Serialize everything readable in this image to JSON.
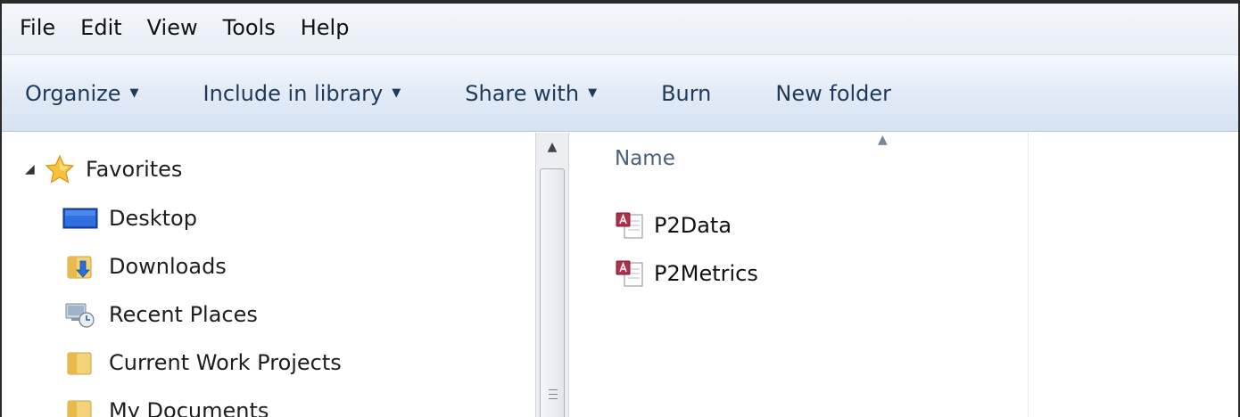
{
  "menubar": {
    "items": [
      "File",
      "Edit",
      "View",
      "Tools",
      "Help"
    ]
  },
  "toolbar": {
    "organize": "Organize",
    "include_in_library": "Include in library",
    "share_with": "Share with",
    "burn": "Burn",
    "new_folder": "New folder"
  },
  "nav": {
    "favorites": "Favorites",
    "items": [
      {
        "label": "Desktop",
        "icon": "desktop-icon"
      },
      {
        "label": "Downloads",
        "icon": "downloads-folder-icon"
      },
      {
        "label": "Recent Places",
        "icon": "recent-places-icon"
      },
      {
        "label": "Current Work Projects",
        "icon": "folder-icon"
      },
      {
        "label": "My Documents",
        "icon": "folder-icon"
      }
    ]
  },
  "content": {
    "column_name": "Name",
    "files": [
      {
        "name": "P2Data",
        "icon": "access-database-icon"
      },
      {
        "name": "P2Metrics",
        "icon": "access-database-icon"
      }
    ]
  },
  "colors": {
    "toolbar_text": "#1e395b",
    "header_text": "#4c607a",
    "access_red": "#b0304a"
  }
}
